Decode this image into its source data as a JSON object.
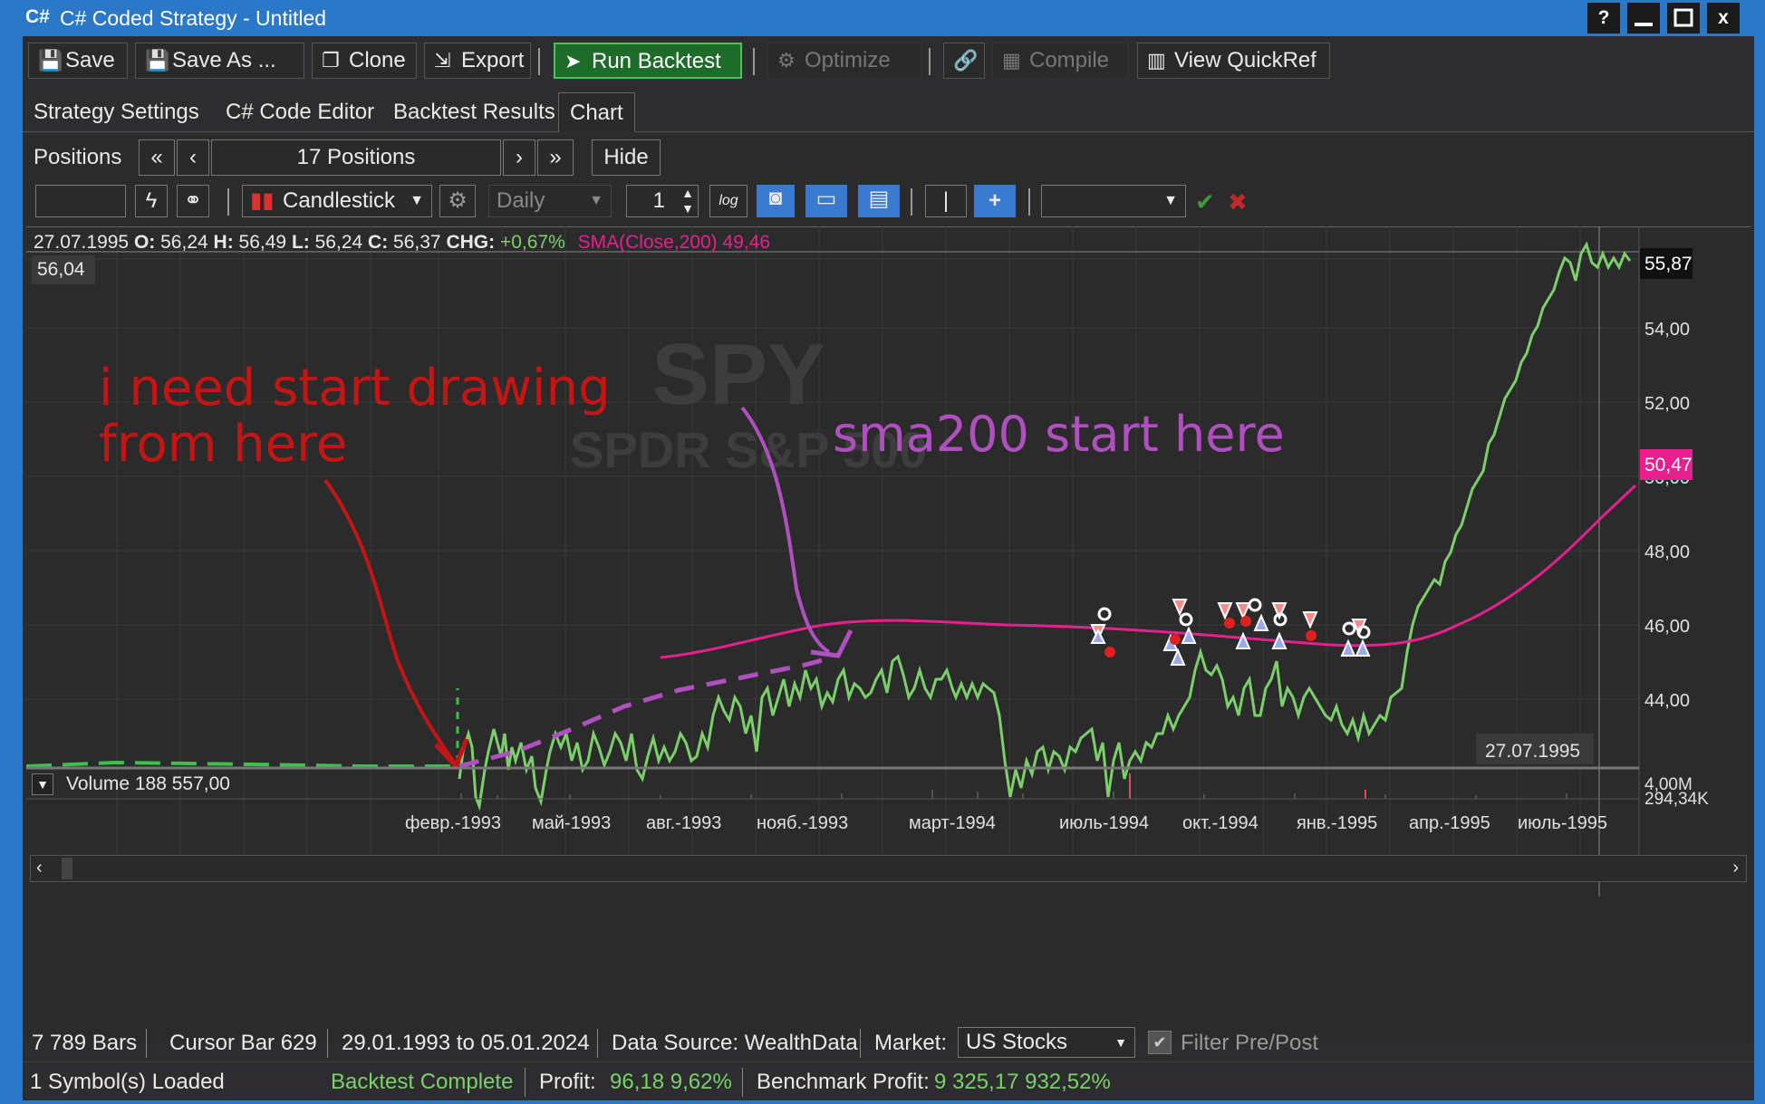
{
  "window": {
    "logo": "C#",
    "title": "C# Coded Strategy - Untitled",
    "buttons": {
      "help": "?",
      "minimize": "—",
      "maximize": "□",
      "close": "x"
    }
  },
  "toolbar": {
    "save": "Save",
    "save_as": "Save As ...",
    "clone": "Clone",
    "export": "Export",
    "run_backtest": "Run Backtest",
    "optimize": "Optimize",
    "compile": "Compile",
    "view_quickref": "View QuickRef"
  },
  "tabs": [
    {
      "label": "Strategy Settings"
    },
    {
      "label": "C# Code Editor"
    },
    {
      "label": "Backtest Results"
    },
    {
      "label": "Chart"
    }
  ],
  "positions": {
    "label": "Positions",
    "count": "17 Positions",
    "hide": "Hide"
  },
  "controls": {
    "chart_style": "Candlestick",
    "scale": "Daily",
    "scale_value": "1",
    "log_label": "log"
  },
  "chart": {
    "header": {
      "date": "27.07.1995",
      "o_label": "O:",
      "o": "56,24",
      "h_label": "H:",
      "h": "56,49",
      "l_label": "L:",
      "l": "56,24",
      "c_label": "C:",
      "c": "56,37",
      "chg_label": "CHG:",
      "chg": "+0,67%",
      "sma": "SMA(Close,200) 49,46"
    },
    "top_left_value": "56,04",
    "watermark_symbol": "SPY",
    "watermark_name": "SPDR S&P 500",
    "price_ticks": [
      "54,00",
      "52,00",
      "50,00",
      "48,00",
      "46,00",
      "44,00"
    ],
    "last_price_tag": "55,87",
    "sma_tag": "50,47",
    "cursor_date": "27.07.1995",
    "volume_label": "Volume 188 557,00",
    "volume_ticks": [
      "4,00M",
      "294,34K"
    ],
    "date_ticks": [
      "февр.-1993",
      "май-1993",
      "авг.-1993",
      "нояб.-1993",
      "март-1994",
      "июль-1994",
      "окт.-1994",
      "янв.-1995",
      "апр.-1995",
      "июль-1995"
    ],
    "annotation_red": [
      "i need start drawing",
      "from here"
    ],
    "annotation_purple": "sma200 start here",
    "colors": {
      "price": "#7bd06b",
      "sma": "#e8208f",
      "annotation_red": "#c41515",
      "annotation_purple": "#b04fc0"
    }
  },
  "chart_data": {
    "type": "line",
    "series": [
      {
        "name": "SMA(Close,200)",
        "values": []
      }
    ],
    "ylim": [
      43,
      57
    ]
  },
  "status": {
    "bars": "7 789 Bars",
    "cursor_bar": "Cursor Bar 629",
    "range": "29.01.1993 to 05.01.2024",
    "data_source": "Data Source: WealthData",
    "market_label": "Market:",
    "market_value": "US Stocks",
    "filter": "Filter Pre/Post",
    "symbols_loaded": "1 Symbol(s) Loaded",
    "backtest_state": "Backtest Complete",
    "profit_label": "Profit:",
    "profit_value": "96,18 9,62%",
    "benchmark_label": "Benchmark Profit:",
    "benchmark_value": "9 325,17 932,52%"
  }
}
